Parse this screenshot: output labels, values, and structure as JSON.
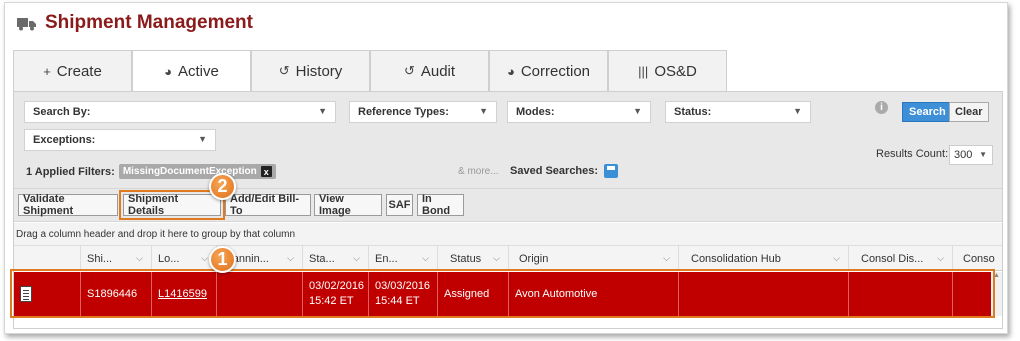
{
  "app": {
    "title": "Shipment Management"
  },
  "tabs": [
    {
      "label": "Create",
      "glyph": "+"
    },
    {
      "label": "Active",
      "glyph": "◕"
    },
    {
      "label": "History",
      "glyph": "↺"
    },
    {
      "label": "Audit",
      "glyph": "↺"
    },
    {
      "label": "Correction",
      "glyph": "◕"
    },
    {
      "label": "OS&D",
      "glyph": "|||"
    }
  ],
  "filters": {
    "search_by": "Search By:",
    "reference_types": "Reference Types:",
    "modes": "Modes:",
    "status": "Status:",
    "exceptions": "Exceptions:",
    "applied_label": "1 Applied Filters:",
    "applied_chip": "MissingDocumentException",
    "chip_remove": "x",
    "and_more": "& more...",
    "saved_searches": "Saved Searches:",
    "info": "i",
    "search_button": "Search",
    "clear_button": "Clear",
    "results_count_label": "Results Count:",
    "results_count_value": "300"
  },
  "toolbar": {
    "validate": "Validate Shipment",
    "details": "Shipment Details",
    "add_edit_bill_to": "Add/Edit Bill-To",
    "view_image": "View Image",
    "saf": "SAF",
    "in_bond": "In Bond"
  },
  "grid": {
    "drag_hint": "Drag a column header and drop it here to group by that column",
    "headers": [
      "Shi...",
      "Lo...",
      "Plannin...",
      "Sta...",
      "En...",
      "Status",
      "Origin",
      "Consolidation Hub",
      "Consol Dis...",
      "Conso"
    ],
    "row": {
      "shipment": "S1896446",
      "load": "L1416599",
      "planning": "",
      "start_date": "03/02/2016",
      "start_time": "15:42 ET",
      "end_date": "03/03/2016",
      "end_time": "15:44 ET",
      "status": "Assigned",
      "origin": "Avon Automotive"
    }
  },
  "callouts": {
    "one": "1",
    "two": "2"
  },
  "colors": {
    "brand": "#8b1a1a",
    "row_selected": "#c00000",
    "highlight": "#e07a20",
    "search": "#3d8fd8"
  }
}
